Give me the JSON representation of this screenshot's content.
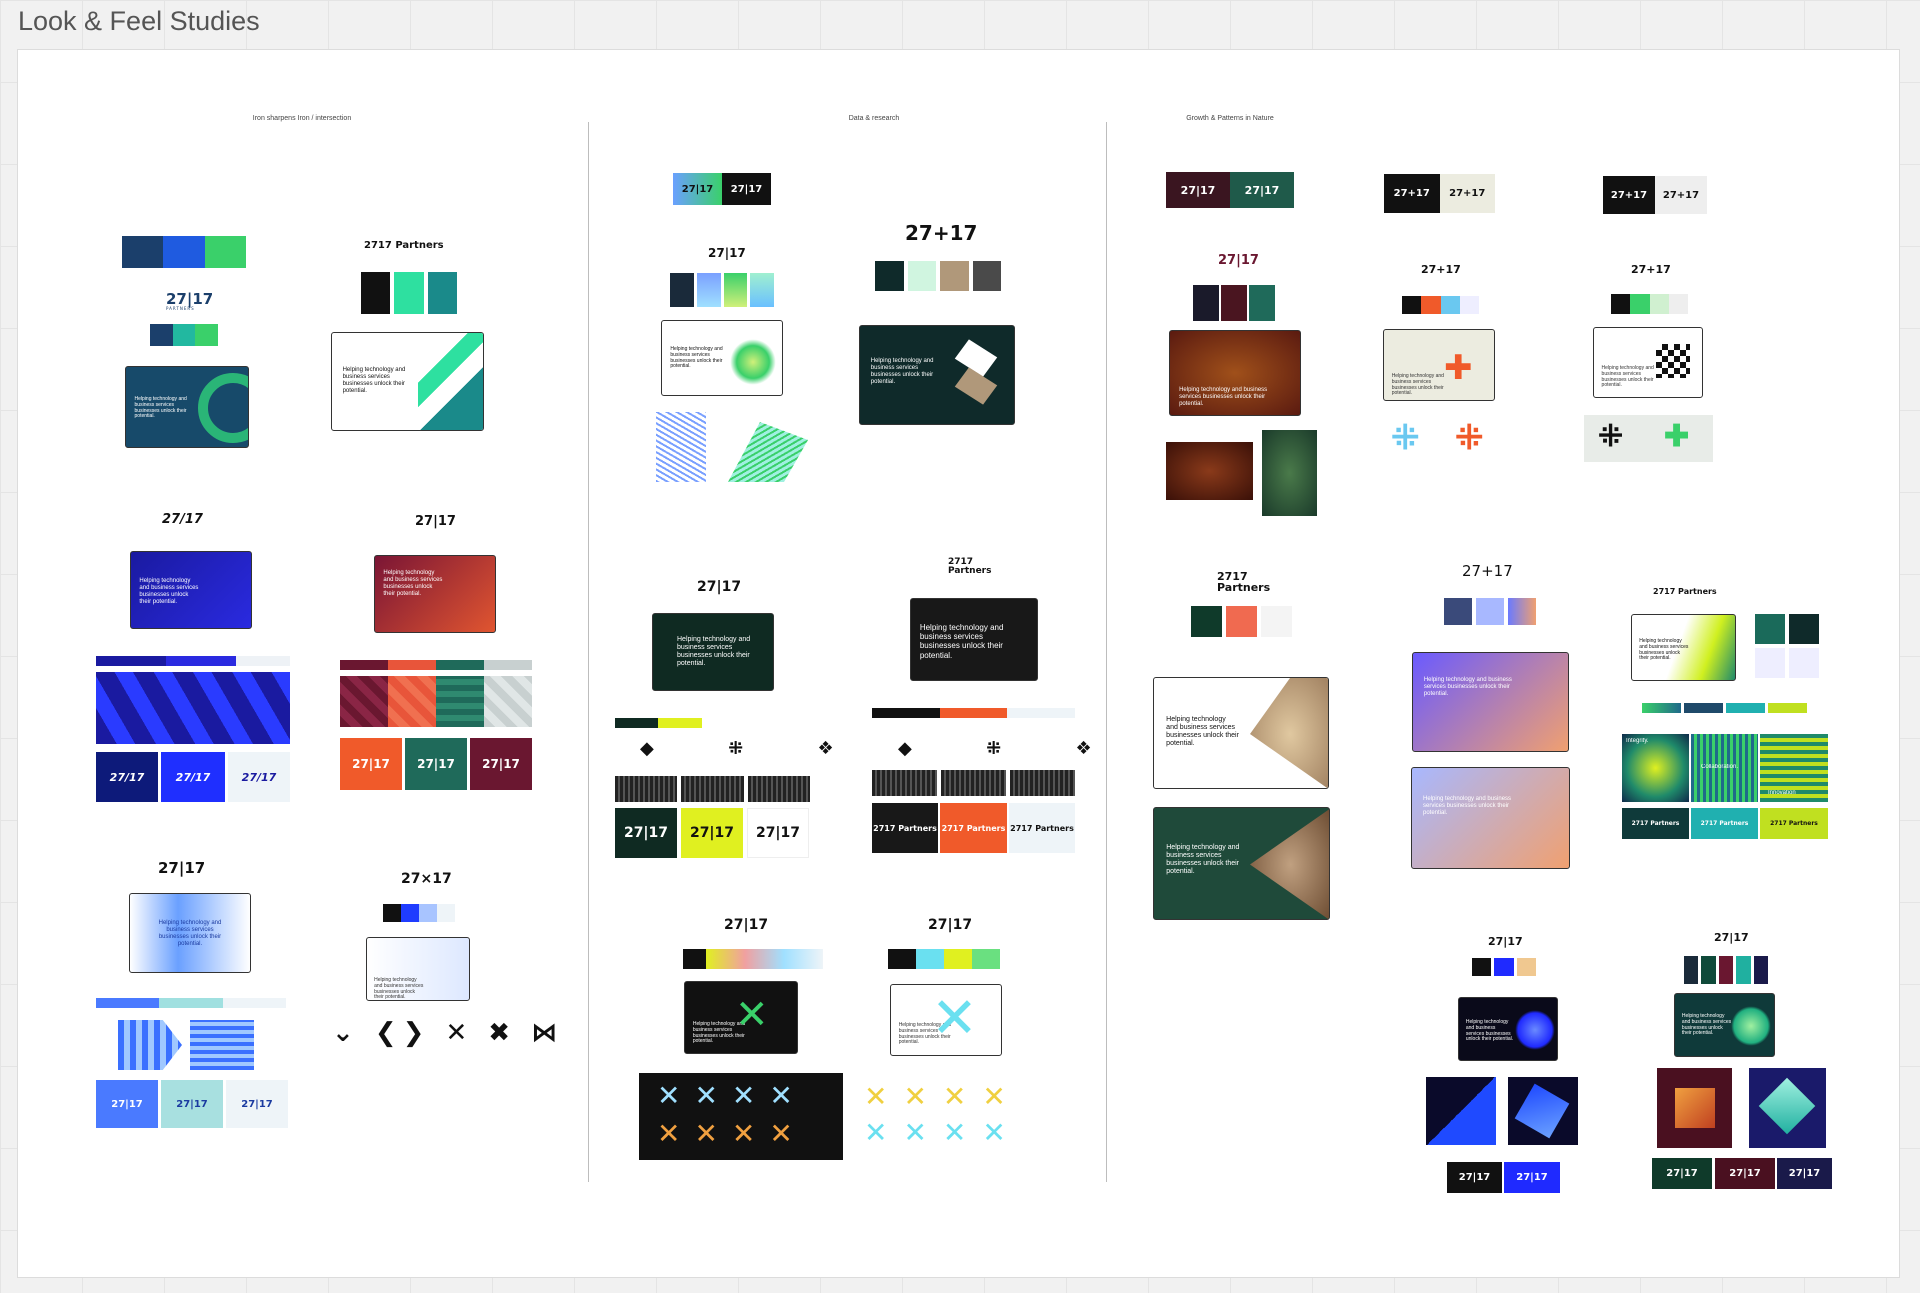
{
  "board": {
    "title": "Look & Feel Studies"
  },
  "columns": [
    {
      "label": "Iron sharpens Iron / intersection"
    },
    {
      "label": "Data & research"
    },
    {
      "label": "Growth & Patterns in Nature"
    }
  ],
  "brand": {
    "wordmark": "27|17",
    "wordmark_slash": "27/17",
    "wordmark_plus": "27+17",
    "wordmark_x": "27×17",
    "partners": "PARTNERS",
    "name": "2717 Partners",
    "name_two_line": "2717\nPartners"
  },
  "mock_copy": {
    "hero": "Helping technology and business services businesses unlock their potential.",
    "hero_accent_1": "technology",
    "hero_accent_2": "businesses"
  },
  "pattern_labels": {
    "integrity": "Integrity.",
    "collaboration": "Collaboration.",
    "innovation": "Innovation"
  },
  "colors": {
    "navy": "#1b3f6b",
    "blue": "#1f3cff",
    "green": "#3ad06a",
    "teal": "#1a6b6a",
    "lime": "#d9f02a",
    "orange": "#f05a2a",
    "maroon": "#6a1730",
    "dark": "#0f2a2a"
  }
}
